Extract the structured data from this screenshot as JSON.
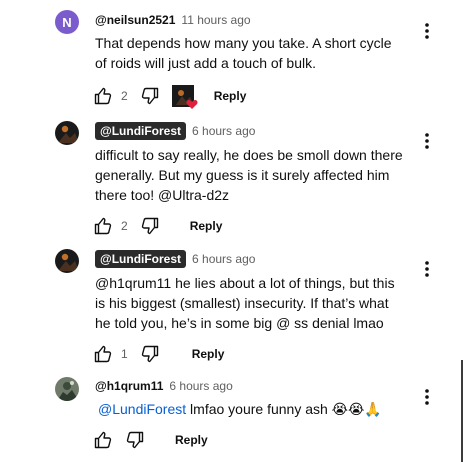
{
  "comments": [
    {
      "avatar_letter": "N",
      "author": "@neilsun2521",
      "time": "11 hours ago",
      "text_lines": [
        "That depends how many you take. A short cycle",
        "of roids will just add a touch of bulk."
      ],
      "likes": "2",
      "hearted": true,
      "reply_label": "Reply"
    },
    {
      "author": "@LundiForest",
      "time": "6 hours ago",
      "text_lines": [
        "difficult to say really, he does be smoll down there",
        "generally. But my guess is it surely affected him",
        "there too! @Ultra-d2z"
      ],
      "likes": "2",
      "reply_label": "Reply"
    },
    {
      "author": "@LundiForest",
      "time": "6 hours ago",
      "text_lines": [
        "@h1qrum11 he lies about a lot of things, but this",
        "is his biggest (smallest) insecurity. If that’s what",
        "he told you, he’s in some big @ ss denial lmao"
      ],
      "likes": "1",
      "reply_label": "Reply"
    },
    {
      "author": "@h1qrum11",
      "time": "6 hours ago",
      "mention": "@LundiForest",
      "text": "lmfao youre funny ash 😭😭🙏",
      "reply_label": "Reply"
    }
  ],
  "colors": {
    "mention": "#065fd4",
    "heart": "#e0213b",
    "avatar_n": "#7b5ccc"
  },
  "icons": [
    "like-icon",
    "dislike-icon",
    "more-vert-icon",
    "heart-icon"
  ]
}
